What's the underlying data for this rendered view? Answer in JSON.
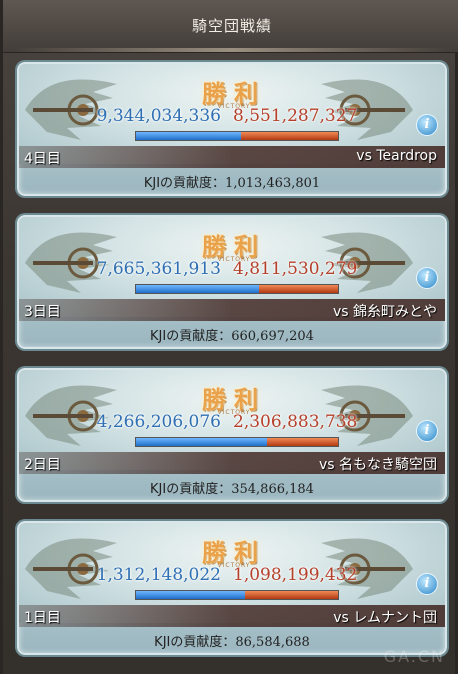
{
  "header": {
    "title": "騎空団戦績"
  },
  "victory_label": "勝利",
  "victory_sub": "VICTORY",
  "colors": {
    "ours": "#2f6fb3",
    "theirs": "#b5402a",
    "bar_ours": "#1f6fc8",
    "bar_theirs": "#b33a12"
  },
  "battles": [
    {
      "day": "4日目",
      "opponent": "vs Teardrop",
      "our_score": "9,344,034,336",
      "their_score": "8,551,287,327",
      "our_share": 0.52,
      "contrib_label": "KJIの貢献度：",
      "contrib_value": "1,013,463,801"
    },
    {
      "day": "3日目",
      "opponent": "vs 錦糸町みとや",
      "our_score": "7,665,361,913",
      "their_score": "4,811,530,279",
      "our_share": 0.61,
      "contrib_label": "KJIの貢献度：",
      "contrib_value": "660,697,204"
    },
    {
      "day": "2日目",
      "opponent": "vs 名もなき騎空団",
      "our_score": "4,266,206,076",
      "their_score": "2,306,883,738",
      "our_share": 0.65,
      "contrib_label": "KJIの貢献度：",
      "contrib_value": "354,866,184"
    },
    {
      "day": "1日目",
      "opponent": "vs レムナント団",
      "our_score": "1,312,148,022",
      "their_score": "1,098,199,432",
      "our_share": 0.54,
      "contrib_label": "KJIの貢献度：",
      "contrib_value": "86,584,688"
    }
  ],
  "icons": {
    "info": "info-icon"
  },
  "watermark": "GA.CN"
}
